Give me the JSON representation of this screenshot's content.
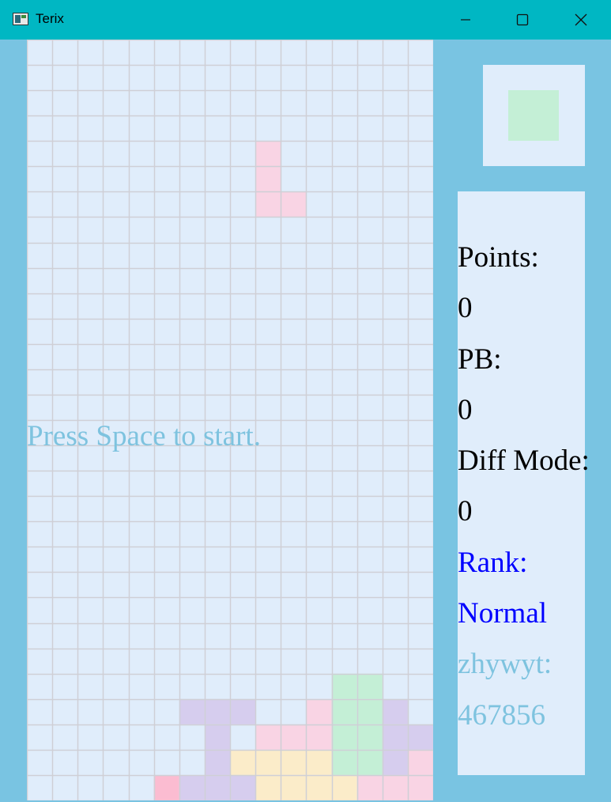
{
  "window": {
    "title": "Terix",
    "minimize_icon": "minimize-icon",
    "maximize_icon": "maximize-icon",
    "close_icon": "close-icon"
  },
  "colors": {
    "frame": "#79c4e2",
    "titlebar": "#00b7c3",
    "board_bg": "#e0edfb",
    "grid_line": "#cfcfd6",
    "message": "#7ec3df",
    "stat_text": "#000000",
    "rank_text": "#0000ff",
    "player_text": "#7ec3df",
    "pink": "#f9d4e4",
    "purple": "#d6cdee",
    "green": "#c4efd6",
    "cream": "#fbecc9",
    "hot_pink": "#fbbcd1"
  },
  "board": {
    "columns": 16,
    "rows": 30,
    "cells": [
      {
        "col": 9,
        "row": 4,
        "color": "pink"
      },
      {
        "col": 9,
        "row": 5,
        "color": "pink"
      },
      {
        "col": 9,
        "row": 6,
        "color": "pink"
      },
      {
        "col": 10,
        "row": 6,
        "color": "pink"
      },
      {
        "col": 12,
        "row": 25,
        "color": "green"
      },
      {
        "col": 13,
        "row": 25,
        "color": "green"
      },
      {
        "col": 6,
        "row": 26,
        "color": "purple"
      },
      {
        "col": 7,
        "row": 26,
        "color": "purple"
      },
      {
        "col": 8,
        "row": 26,
        "color": "purple"
      },
      {
        "col": 11,
        "row": 26,
        "color": "pink"
      },
      {
        "col": 12,
        "row": 26,
        "color": "green"
      },
      {
        "col": 13,
        "row": 26,
        "color": "green"
      },
      {
        "col": 14,
        "row": 26,
        "color": "purple"
      },
      {
        "col": 7,
        "row": 27,
        "color": "purple"
      },
      {
        "col": 9,
        "row": 27,
        "color": "pink"
      },
      {
        "col": 10,
        "row": 27,
        "color": "pink"
      },
      {
        "col": 11,
        "row": 27,
        "color": "pink"
      },
      {
        "col": 12,
        "row": 27,
        "color": "green"
      },
      {
        "col": 13,
        "row": 27,
        "color": "green"
      },
      {
        "col": 14,
        "row": 27,
        "color": "purple"
      },
      {
        "col": 15,
        "row": 27,
        "color": "purple"
      },
      {
        "col": 7,
        "row": 28,
        "color": "purple"
      },
      {
        "col": 8,
        "row": 28,
        "color": "cream"
      },
      {
        "col": 9,
        "row": 28,
        "color": "cream"
      },
      {
        "col": 10,
        "row": 28,
        "color": "cream"
      },
      {
        "col": 11,
        "row": 28,
        "color": "cream"
      },
      {
        "col": 12,
        "row": 28,
        "color": "green"
      },
      {
        "col": 13,
        "row": 28,
        "color": "green"
      },
      {
        "col": 14,
        "row": 28,
        "color": "purple"
      },
      {
        "col": 15,
        "row": 28,
        "color": "pink"
      },
      {
        "col": 5,
        "row": 29,
        "color": "hot_pink"
      },
      {
        "col": 6,
        "row": 29,
        "color": "purple"
      },
      {
        "col": 7,
        "row": 29,
        "color": "purple"
      },
      {
        "col": 8,
        "row": 29,
        "color": "purple"
      },
      {
        "col": 9,
        "row": 29,
        "color": "cream"
      },
      {
        "col": 10,
        "row": 29,
        "color": "cream"
      },
      {
        "col": 11,
        "row": 29,
        "color": "cream"
      },
      {
        "col": 12,
        "row": 29,
        "color": "cream"
      },
      {
        "col": 13,
        "row": 29,
        "color": "pink"
      },
      {
        "col": 14,
        "row": 29,
        "color": "pink"
      },
      {
        "col": 15,
        "row": 29,
        "color": "pink"
      }
    ]
  },
  "message": "Press Space to start.",
  "next_piece": {
    "shape": "O",
    "color": "green"
  },
  "stats": {
    "points_label": "Points:",
    "points_value": "0",
    "pb_label": "PB:",
    "pb_value": "0",
    "diff_label": "Diff Mode:",
    "diff_value": "0",
    "rank_label": "Rank:",
    "rank_value": "Normal",
    "player_label": "zhywyt:",
    "player_value": "467856"
  }
}
